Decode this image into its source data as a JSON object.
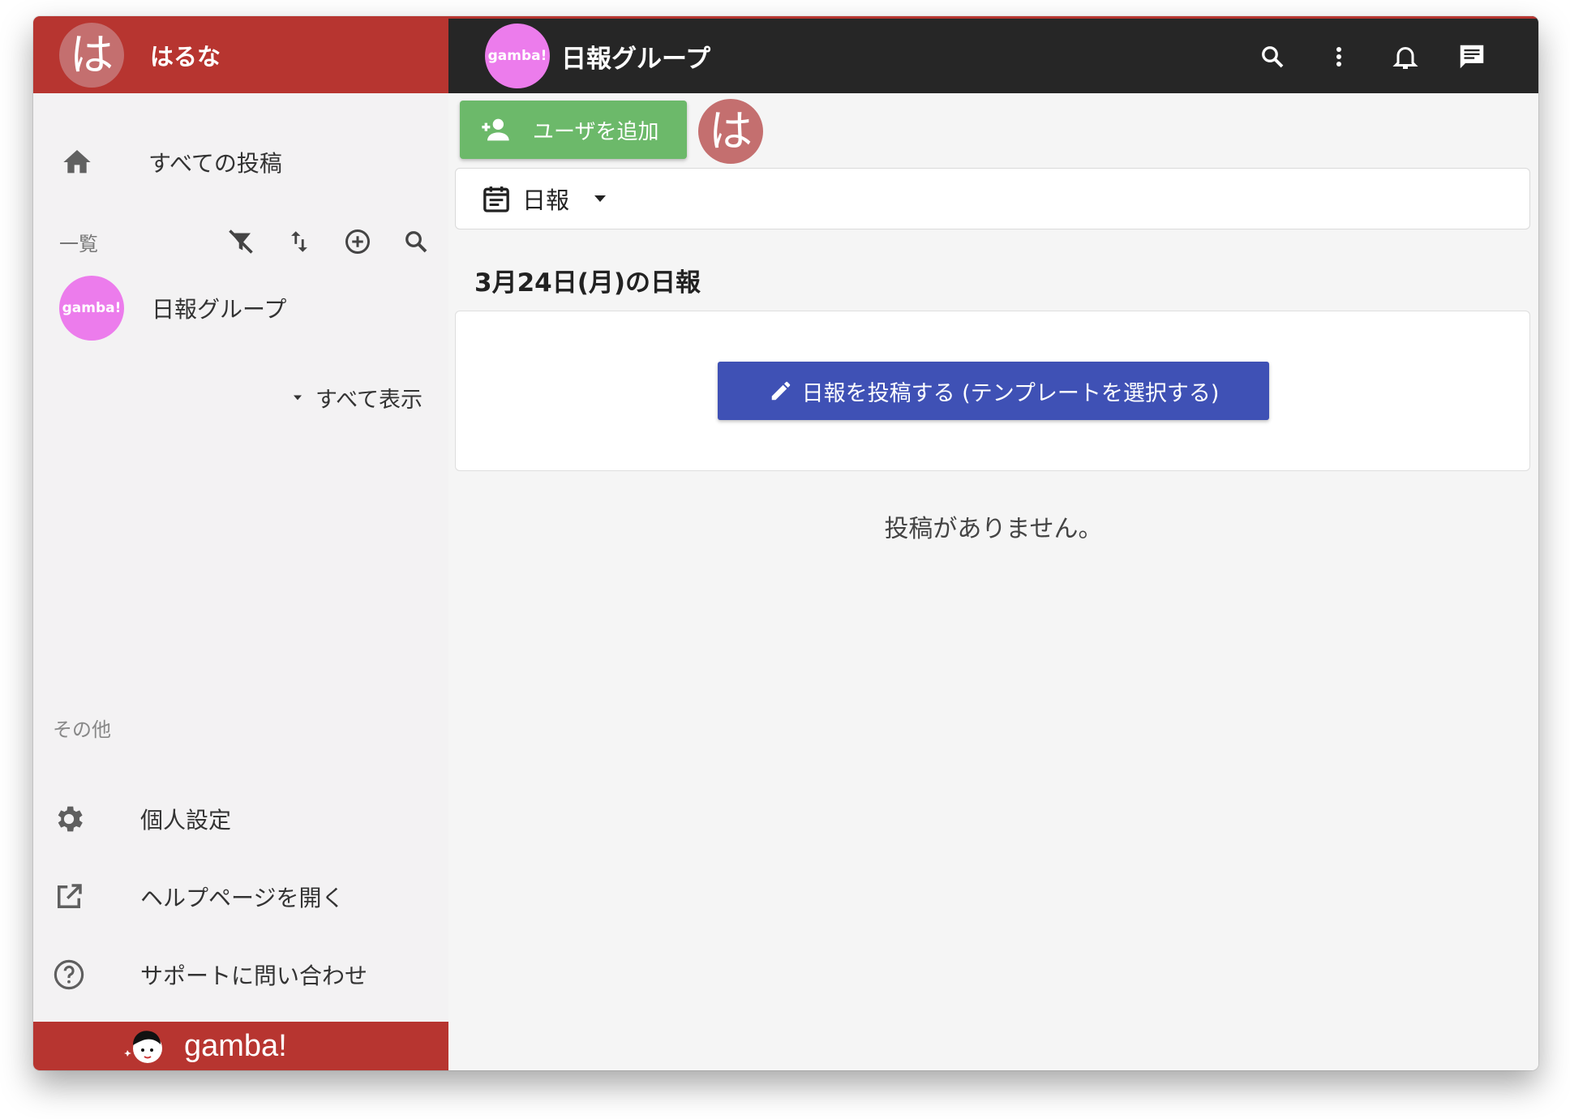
{
  "sidebar": {
    "user_initial": "は",
    "user_name": "はるな",
    "home_label": "すべての投稿",
    "list_title": "一覧",
    "group": {
      "avatar_text": "gamba!",
      "name": "日報グループ"
    },
    "show_all_label": "すべて表示",
    "other_title": "その他",
    "other_items": [
      {
        "label": "個人設定",
        "icon": "gear-icon"
      },
      {
        "label": "ヘルプページを開く",
        "icon": "open-in-new-icon"
      },
      {
        "label": "サポートに問い合わせ",
        "icon": "help-circle-icon"
      }
    ],
    "footer_logo": "gamba!"
  },
  "topbar": {
    "avatar_text": "gamba!",
    "title": "日報グループ",
    "icons": [
      "search-icon",
      "more-vertical-icon",
      "bell-icon",
      "message-icon"
    ]
  },
  "main": {
    "add_user_label": "ユーザを追加",
    "member_initial": "は",
    "type_label": "日報",
    "date_heading": "3月24日(月)の日報",
    "post_button_label": "日報を投稿する (テンプレートを選択する)",
    "empty_message": "投稿がありません。"
  },
  "colors": {
    "brand_red": "#b73530",
    "topbar_dark": "#262626",
    "add_user_green": "#6cb96a",
    "post_button_blue": "#3f51b5",
    "group_avatar_pink": "#ec7cec",
    "user_avatar": "#c46f6f"
  }
}
